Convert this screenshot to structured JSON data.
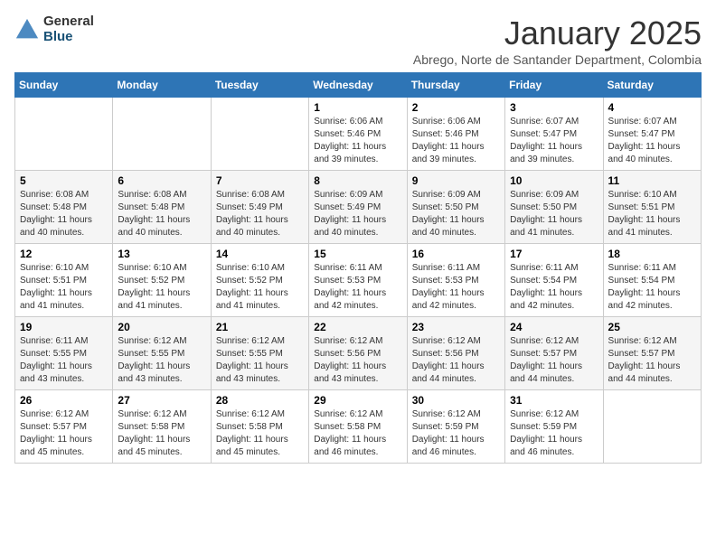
{
  "header": {
    "logo_general": "General",
    "logo_blue": "Blue",
    "month_title": "January 2025",
    "subtitle": "Abrego, Norte de Santander Department, Colombia"
  },
  "days_of_week": [
    "Sunday",
    "Monday",
    "Tuesday",
    "Wednesday",
    "Thursday",
    "Friday",
    "Saturday"
  ],
  "weeks": [
    {
      "days": [
        {
          "num": "",
          "info": ""
        },
        {
          "num": "",
          "info": ""
        },
        {
          "num": "",
          "info": ""
        },
        {
          "num": "1",
          "info": "Sunrise: 6:06 AM\nSunset: 5:46 PM\nDaylight: 11 hours\nand 39 minutes."
        },
        {
          "num": "2",
          "info": "Sunrise: 6:06 AM\nSunset: 5:46 PM\nDaylight: 11 hours\nand 39 minutes."
        },
        {
          "num": "3",
          "info": "Sunrise: 6:07 AM\nSunset: 5:47 PM\nDaylight: 11 hours\nand 39 minutes."
        },
        {
          "num": "4",
          "info": "Sunrise: 6:07 AM\nSunset: 5:47 PM\nDaylight: 11 hours\nand 40 minutes."
        }
      ]
    },
    {
      "days": [
        {
          "num": "5",
          "info": "Sunrise: 6:08 AM\nSunset: 5:48 PM\nDaylight: 11 hours\nand 40 minutes."
        },
        {
          "num": "6",
          "info": "Sunrise: 6:08 AM\nSunset: 5:48 PM\nDaylight: 11 hours\nand 40 minutes."
        },
        {
          "num": "7",
          "info": "Sunrise: 6:08 AM\nSunset: 5:49 PM\nDaylight: 11 hours\nand 40 minutes."
        },
        {
          "num": "8",
          "info": "Sunrise: 6:09 AM\nSunset: 5:49 PM\nDaylight: 11 hours\nand 40 minutes."
        },
        {
          "num": "9",
          "info": "Sunrise: 6:09 AM\nSunset: 5:50 PM\nDaylight: 11 hours\nand 40 minutes."
        },
        {
          "num": "10",
          "info": "Sunrise: 6:09 AM\nSunset: 5:50 PM\nDaylight: 11 hours\nand 41 minutes."
        },
        {
          "num": "11",
          "info": "Sunrise: 6:10 AM\nSunset: 5:51 PM\nDaylight: 11 hours\nand 41 minutes."
        }
      ]
    },
    {
      "days": [
        {
          "num": "12",
          "info": "Sunrise: 6:10 AM\nSunset: 5:51 PM\nDaylight: 11 hours\nand 41 minutes."
        },
        {
          "num": "13",
          "info": "Sunrise: 6:10 AM\nSunset: 5:52 PM\nDaylight: 11 hours\nand 41 minutes."
        },
        {
          "num": "14",
          "info": "Sunrise: 6:10 AM\nSunset: 5:52 PM\nDaylight: 11 hours\nand 41 minutes."
        },
        {
          "num": "15",
          "info": "Sunrise: 6:11 AM\nSunset: 5:53 PM\nDaylight: 11 hours\nand 42 minutes."
        },
        {
          "num": "16",
          "info": "Sunrise: 6:11 AM\nSunset: 5:53 PM\nDaylight: 11 hours\nand 42 minutes."
        },
        {
          "num": "17",
          "info": "Sunrise: 6:11 AM\nSunset: 5:54 PM\nDaylight: 11 hours\nand 42 minutes."
        },
        {
          "num": "18",
          "info": "Sunrise: 6:11 AM\nSunset: 5:54 PM\nDaylight: 11 hours\nand 42 minutes."
        }
      ]
    },
    {
      "days": [
        {
          "num": "19",
          "info": "Sunrise: 6:11 AM\nSunset: 5:55 PM\nDaylight: 11 hours\nand 43 minutes."
        },
        {
          "num": "20",
          "info": "Sunrise: 6:12 AM\nSunset: 5:55 PM\nDaylight: 11 hours\nand 43 minutes."
        },
        {
          "num": "21",
          "info": "Sunrise: 6:12 AM\nSunset: 5:55 PM\nDaylight: 11 hours\nand 43 minutes."
        },
        {
          "num": "22",
          "info": "Sunrise: 6:12 AM\nSunset: 5:56 PM\nDaylight: 11 hours\nand 43 minutes."
        },
        {
          "num": "23",
          "info": "Sunrise: 6:12 AM\nSunset: 5:56 PM\nDaylight: 11 hours\nand 44 minutes."
        },
        {
          "num": "24",
          "info": "Sunrise: 6:12 AM\nSunset: 5:57 PM\nDaylight: 11 hours\nand 44 minutes."
        },
        {
          "num": "25",
          "info": "Sunrise: 6:12 AM\nSunset: 5:57 PM\nDaylight: 11 hours\nand 44 minutes."
        }
      ]
    },
    {
      "days": [
        {
          "num": "26",
          "info": "Sunrise: 6:12 AM\nSunset: 5:57 PM\nDaylight: 11 hours\nand 45 minutes."
        },
        {
          "num": "27",
          "info": "Sunrise: 6:12 AM\nSunset: 5:58 PM\nDaylight: 11 hours\nand 45 minutes."
        },
        {
          "num": "28",
          "info": "Sunrise: 6:12 AM\nSunset: 5:58 PM\nDaylight: 11 hours\nand 45 minutes."
        },
        {
          "num": "29",
          "info": "Sunrise: 6:12 AM\nSunset: 5:58 PM\nDaylight: 11 hours\nand 46 minutes."
        },
        {
          "num": "30",
          "info": "Sunrise: 6:12 AM\nSunset: 5:59 PM\nDaylight: 11 hours\nand 46 minutes."
        },
        {
          "num": "31",
          "info": "Sunrise: 6:12 AM\nSunset: 5:59 PM\nDaylight: 11 hours\nand 46 minutes."
        },
        {
          "num": "",
          "info": ""
        }
      ]
    }
  ]
}
